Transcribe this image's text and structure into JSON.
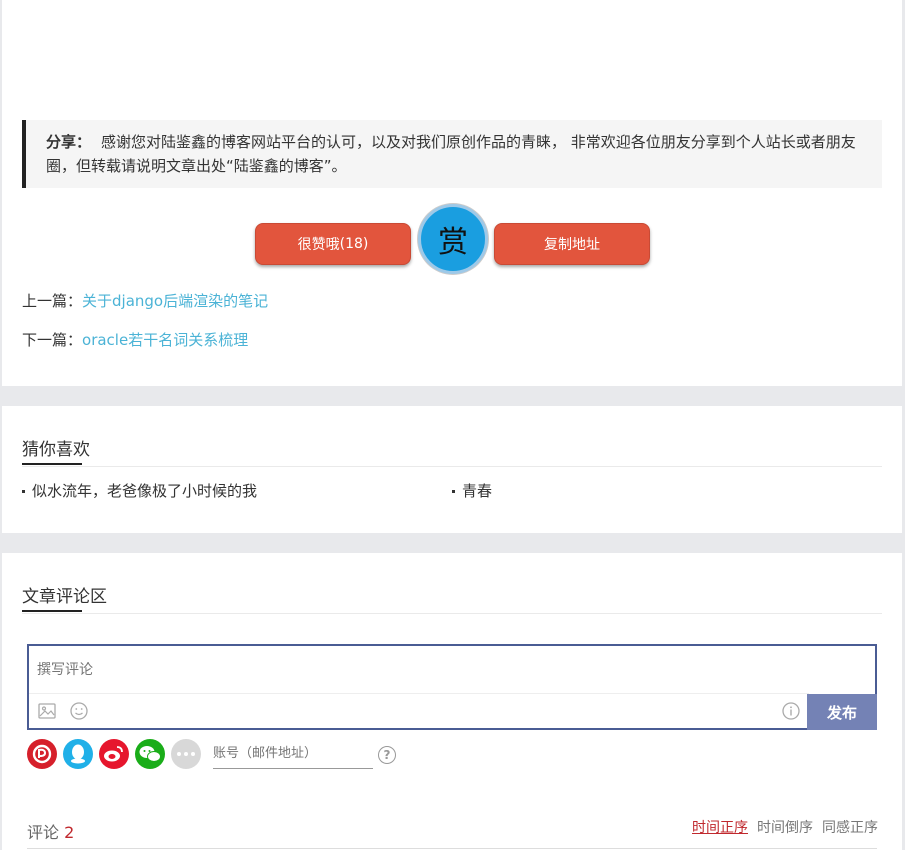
{
  "share": {
    "label": "分享：",
    "text": "感谢您对陆鉴鑫的博客网站平台的认可，以及对我们原创作品的青睐， 非常欢迎各位朋友分享到个人站长或者朋友圈，但转载请说明文章出处“陆鉴鑫的博客”。"
  },
  "actions": {
    "like_label": "很赞哦",
    "like_count": "(18)",
    "reward_label": "赏",
    "copy_label": "复制地址"
  },
  "nav": {
    "prev_prefix": "上一篇：",
    "prev_title": "关于django后端渲染的笔记",
    "next_prefix": "下一篇：",
    "next_title": "oracle若干名词关系梳理"
  },
  "guess": {
    "title": "猜你喜欢",
    "items": [
      "似水流年，老爸像极了小时候的我",
      "青春"
    ]
  },
  "comments": {
    "title": "文章评论区",
    "placeholder": "撰写评论",
    "publish_label": "发布",
    "account_placeholder": "账号（邮件地址）",
    "help_label": "?",
    "count_label": "评论",
    "count": "2",
    "sort_options": [
      "时间正序",
      "时间倒序",
      "同感正序"
    ],
    "social_icons": [
      "netease-icon",
      "qq-icon",
      "weibo-icon",
      "wechat-icon",
      "more-icon"
    ]
  },
  "colors": {
    "button_red": "#e2553d",
    "reward_blue": "#1a9ee0",
    "link_blue": "#4bb3d6",
    "publish_blue": "#7482b5",
    "accent_red": "#c0282d"
  }
}
